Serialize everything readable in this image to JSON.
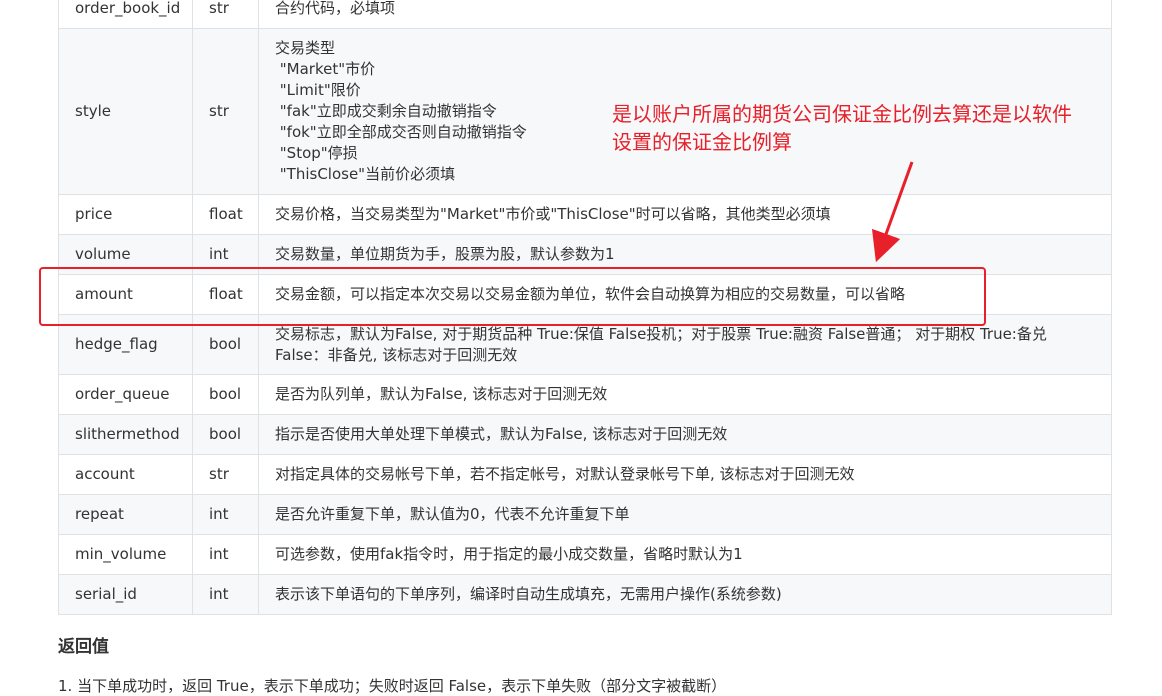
{
  "params_table": {
    "rows": [
      {
        "name": "order_book_id",
        "type": "str",
        "desc": "合约代码，必填项"
      },
      {
        "name": "style",
        "type": "str",
        "desc": ""
      },
      {
        "name": "price",
        "type": "float",
        "desc": "交易价格，当交易类型为\"Market\"市价或\"ThisClose\"时可以省略，其他类型必须填"
      },
      {
        "name": "volume",
        "type": "int",
        "desc": "交易数量，单位期货为手，股票为股，默认参数为1"
      },
      {
        "name": "amount",
        "type": "float",
        "desc": "交易金额，可以指定本次交易以交易金额为单位，软件会自动换算为相应的交易数量，可以省略"
      },
      {
        "name": "hedge_flag",
        "type": "bool",
        "desc_line1": "交易标志，默认为False, 对于期货品种 True:保值 False投机；对于股票 True:融资 False普通； 对于期权 True:备兑",
        "desc_line2": "False：非备兑, 该标志对于回测无效"
      },
      {
        "name": "order_queue",
        "type": "bool",
        "desc": "是否为队列单，默认为False, 该标志对于回测无效"
      },
      {
        "name": "slithermethod",
        "type": "bool",
        "desc": "指示是否使用大单处理下单模式，默认为False, 该标志对于回测无效"
      },
      {
        "name": "account",
        "type": "str",
        "desc": "对指定具体的交易帐号下单，若不指定帐号，对默认登录帐号下单, 该标志对于回测无效"
      },
      {
        "name": "repeat",
        "type": "int",
        "desc": "是否允许重复下单，默认值为0，代表不允许重复下单"
      },
      {
        "name": "min_volume",
        "type": "int",
        "desc": "可选参数，使用fak指令时，用于指定的最小成交数量，省略时默认为1"
      },
      {
        "name": "serial_id",
        "type": "int",
        "desc": "表示该下单语句的下单序列，编译时自动生成填充，无需用户操作(系统参数)"
      }
    ],
    "style_lines": [
      "交易类型",
      " \"Market\"市价",
      " \"Limit\"限价",
      " \"fak\"立即成交剩余自动撤销指令",
      " \"fok\"立即全部成交否则自动撤销指令",
      " \"Stop\"停损",
      " \"ThisClose\"当前价必须填"
    ]
  },
  "section_heading": "返回值",
  "cut_line_text": "1. 当下单成功时，返回 True，表示下单成功；失败时返回 False，表示下单失败（部分文字被截断）",
  "annotation": {
    "text": "是以账户所属的期货公司保证金比例去算还是以软件设置的保证金比例算",
    "color": "#e8202a"
  }
}
